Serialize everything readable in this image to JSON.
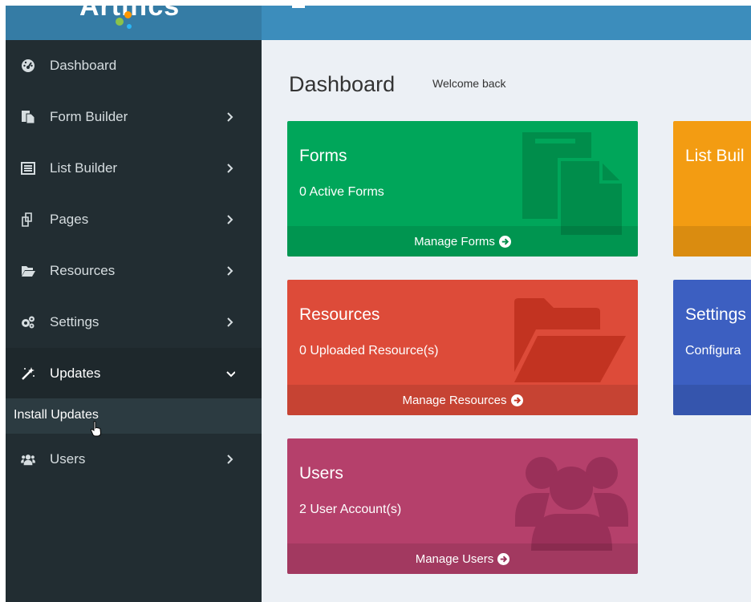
{
  "app": {
    "logo_text": "Artifics"
  },
  "sidebar": {
    "items": [
      {
        "label": "Dashboard",
        "icon": "dashboard-icon",
        "has_chevron": false
      },
      {
        "label": "Form Builder",
        "icon": "form-builder-icon",
        "has_chevron": true
      },
      {
        "label": "List Builder",
        "icon": "list-builder-icon",
        "has_chevron": true
      },
      {
        "label": "Pages",
        "icon": "pages-icon",
        "has_chevron": true
      },
      {
        "label": "Resources",
        "icon": "folder-open-icon",
        "has_chevron": true
      },
      {
        "label": "Settings",
        "icon": "gears-icon",
        "has_chevron": true
      },
      {
        "label": "Updates",
        "icon": "magic-wand-icon",
        "has_chevron": true,
        "expanded": true
      },
      {
        "label": "Users",
        "icon": "users-icon",
        "has_chevron": true
      }
    ],
    "subitem": {
      "label": "Install Updates"
    }
  },
  "main": {
    "title": "Dashboard",
    "subtitle": "Welcome back",
    "boxes": [
      {
        "title": "Forms",
        "count": "0 Active Forms",
        "footer": "Manage Forms",
        "color": "#00a65a"
      },
      {
        "title": "List Buil",
        "count": "",
        "footer": "",
        "color": "#f39c12"
      },
      {
        "title": "Resources",
        "count": "0 Uploaded Resource(s)",
        "footer": "Manage Resources",
        "color": "#dd4b39"
      },
      {
        "title": "Settings",
        "count": "Configura",
        "footer": "",
        "color": "#3c5fc1"
      },
      {
        "title": "Users",
        "count": "2 User Account(s)",
        "footer": "Manage Users",
        "color": "#b5406b"
      }
    ]
  },
  "colors": {
    "sidebar_bg": "#222d32",
    "topbar": "#3c8dbc",
    "logo_bg": "#357ca5",
    "main_bg": "#ecf0f5"
  }
}
